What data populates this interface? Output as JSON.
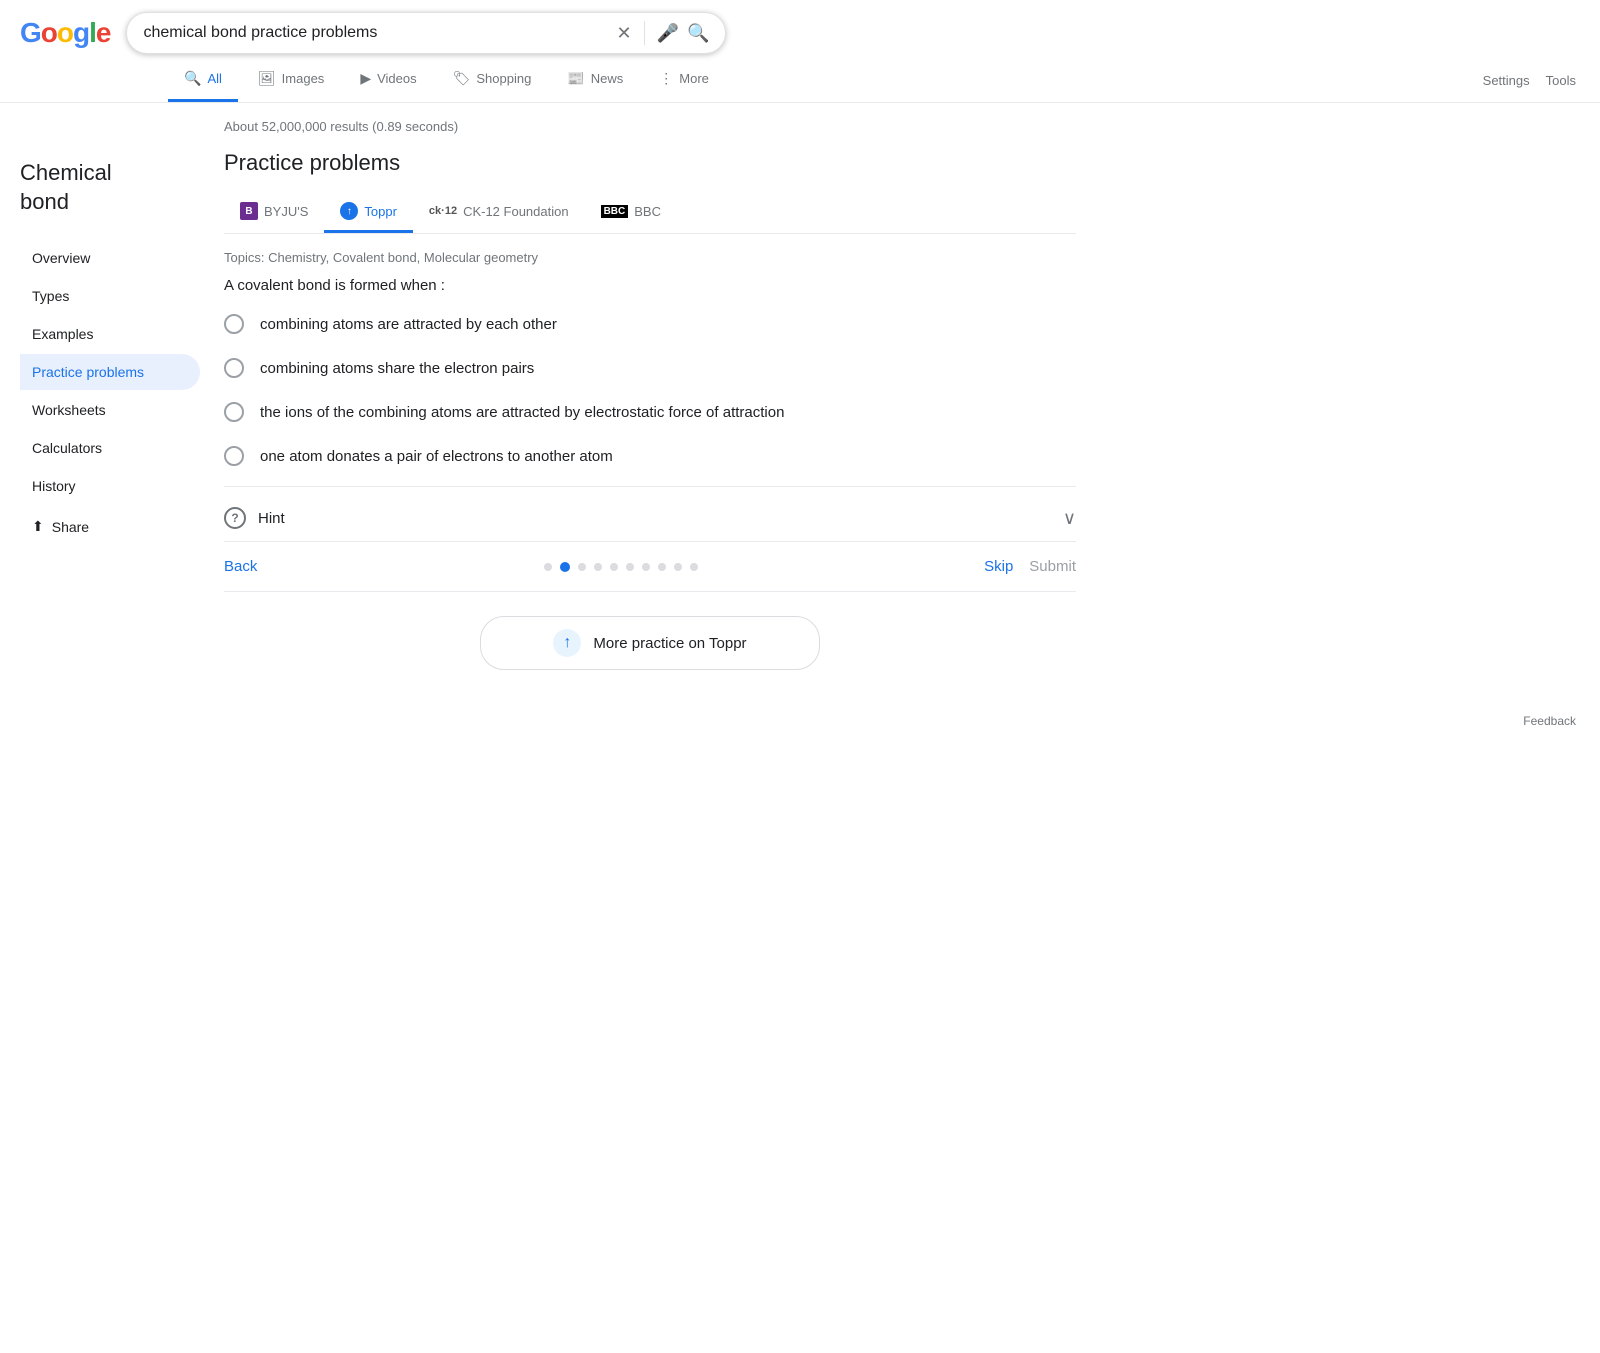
{
  "logo": {
    "g": "G",
    "o1": "o",
    "o2": "o",
    "gl": "g",
    "e": "l",
    "e2": "e"
  },
  "search": {
    "value": "chemical bond practice problems",
    "placeholder": "Search"
  },
  "nav_tabs": [
    {
      "id": "all",
      "label": "All",
      "icon": "🔍",
      "active": true
    },
    {
      "id": "images",
      "label": "Images",
      "icon": "🖼"
    },
    {
      "id": "videos",
      "label": "Videos",
      "icon": "▶"
    },
    {
      "id": "shopping",
      "label": "Shopping",
      "icon": "🏷"
    },
    {
      "id": "news",
      "label": "News",
      "icon": "📰"
    },
    {
      "id": "more",
      "label": "More",
      "icon": "⋮"
    }
  ],
  "settings_label": "Settings",
  "tools_label": "Tools",
  "results_count": "About 52,000,000 results (0.89 seconds)",
  "section_title": "Practice problems",
  "source_tabs": [
    {
      "id": "byjus",
      "label": "BYJU'S",
      "active": false
    },
    {
      "id": "toppr",
      "label": "Toppr",
      "active": true
    },
    {
      "id": "ck12",
      "label": "CK-12 Foundation",
      "active": false
    },
    {
      "id": "bbc",
      "label": "BBC",
      "active": false
    }
  ],
  "topics": "Topics: Chemistry, Covalent bond, Molecular geometry",
  "question_prompt": "A covalent bond is formed when :",
  "answer_options": [
    {
      "id": "a",
      "text": "combining atoms are attracted by each other"
    },
    {
      "id": "b",
      "text": "combining atoms share the electron pairs"
    },
    {
      "id": "c",
      "text": "the ions of the combining atoms are attracted by electrostatic force of attraction"
    },
    {
      "id": "d",
      "text": "one atom donates a pair of electrons to another atom"
    }
  ],
  "hint_label": "Hint",
  "nav": {
    "back_label": "Back",
    "skip_label": "Skip",
    "submit_label": "Submit",
    "dots_total": 10,
    "active_dot": 1
  },
  "more_practice_label": "More practice on Toppr",
  "sidebar": {
    "title_line1": "Chemical",
    "title_line2": "bond",
    "items": [
      {
        "id": "overview",
        "label": "Overview",
        "active": false
      },
      {
        "id": "types",
        "label": "Types",
        "active": false
      },
      {
        "id": "examples",
        "label": "Examples",
        "active": false
      },
      {
        "id": "practice-problems",
        "label": "Practice problems",
        "active": true
      },
      {
        "id": "worksheets",
        "label": "Worksheets",
        "active": false
      },
      {
        "id": "calculators",
        "label": "Calculators",
        "active": false
      },
      {
        "id": "history",
        "label": "History",
        "active": false
      }
    ],
    "share_label": "Share"
  },
  "feedback_label": "Feedback"
}
